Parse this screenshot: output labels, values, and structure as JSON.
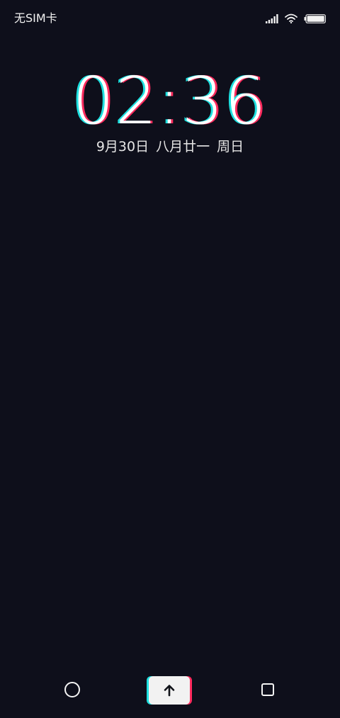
{
  "status_bar": {
    "carrier": "无SIM卡",
    "icons": [
      "signal-icon",
      "wifi-icon",
      "battery-icon"
    ]
  },
  "clock": {
    "time": "02:36"
  },
  "date": {
    "solar": "9月30日",
    "lunar": "八月廿一",
    "weekday": "周日"
  },
  "bottom_bar": {
    "left": "home-circle-icon",
    "center": "swipe-up-arrow-icon",
    "right": "recent-apps-square-icon"
  },
  "colors": {
    "background": "#0e0f1b",
    "glitch_cyan": "#1ee0e0",
    "glitch_red": "#ff2b5e",
    "text": "#ffffff"
  }
}
